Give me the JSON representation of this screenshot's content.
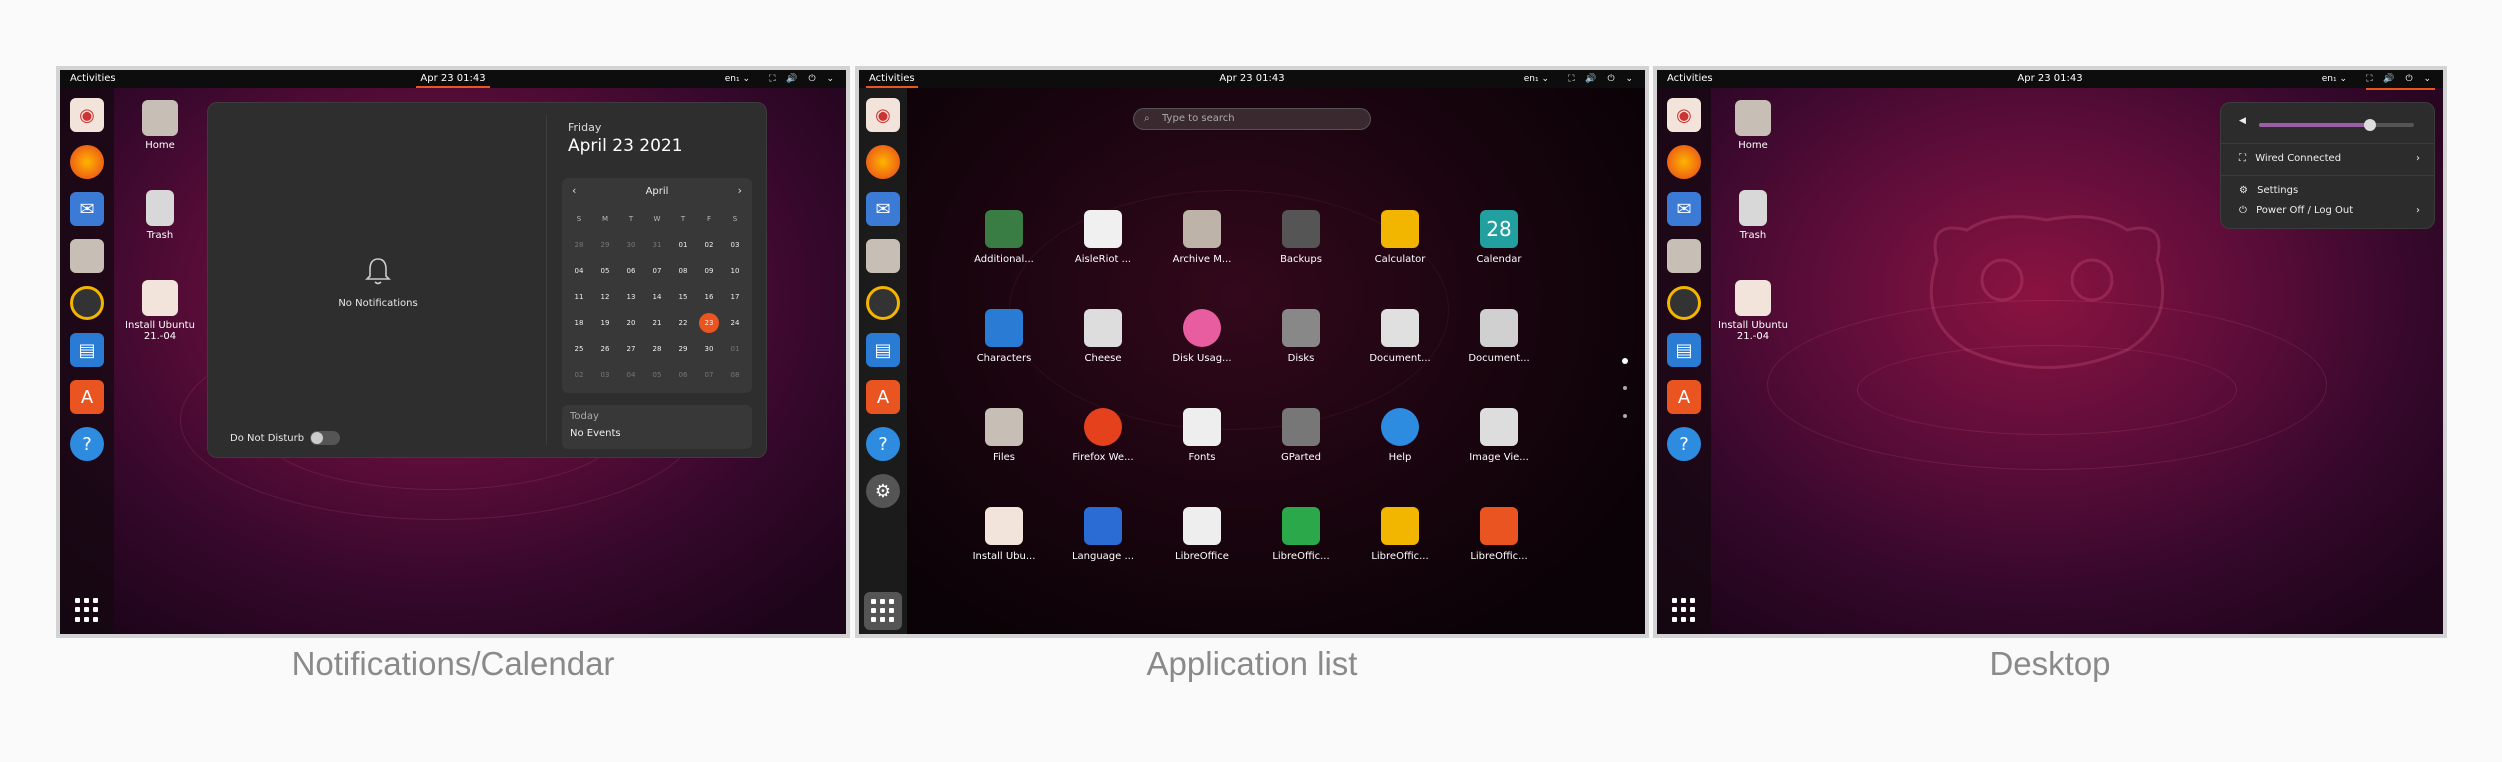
{
  "topbar": {
    "activities": "Activities",
    "clock": "Apr 23  01:43",
    "lang": "en₁ ⌄"
  },
  "captions": [
    "Notifications/Calendar",
    "Application list",
    "Desktop"
  ],
  "desktop_icons": {
    "home": "Home",
    "trash": "Trash",
    "install": "Install Ubuntu 21.-04"
  },
  "notifications": {
    "empty": "No Notifications",
    "dnd": "Do Not Disturb",
    "weekday": "Friday",
    "date": "April 23 2021",
    "month": "April",
    "weekday_headers": [
      "S",
      "M",
      "T",
      "W",
      "T",
      "F",
      "S"
    ],
    "days": [
      "28",
      "29",
      "30",
      "31",
      "01",
      "02",
      "03",
      "04",
      "05",
      "06",
      "07",
      "08",
      "09",
      "10",
      "11",
      "12",
      "13",
      "14",
      "15",
      "16",
      "17",
      "18",
      "19",
      "20",
      "21",
      "22",
      "23",
      "24",
      "25",
      "26",
      "27",
      "28",
      "29",
      "30",
      "01",
      "02",
      "03",
      "04",
      "05",
      "06",
      "07",
      "08"
    ],
    "today_label": "Today",
    "events": "No Events"
  },
  "app_list": {
    "search_placeholder": "Type to search",
    "apps": [
      "Additional...",
      "AisleRiot ...",
      "Archive M...",
      "Backups",
      "Calculator",
      "Calendar",
      "Characters",
      "Cheese",
      "Disk Usag...",
      "Disks",
      "Document...",
      "Document...",
      "Files",
      "Firefox We...",
      "Fonts",
      "GParted",
      "Help",
      "Image Vie...",
      "Install Ubu...",
      "Language ...",
      "LibreOffice",
      "LibreOffic...",
      "LibreOffic...",
      "LibreOffic..."
    ],
    "calendar_icon_num": "28"
  },
  "system_menu": {
    "network": "Wired Connected",
    "settings": "Settings",
    "power": "Power Off / Log Out",
    "volume_level": 0.7
  },
  "colors": {
    "accent": "#e95420",
    "dock": "#14080f",
    "topbar": "#0d0d0d"
  }
}
